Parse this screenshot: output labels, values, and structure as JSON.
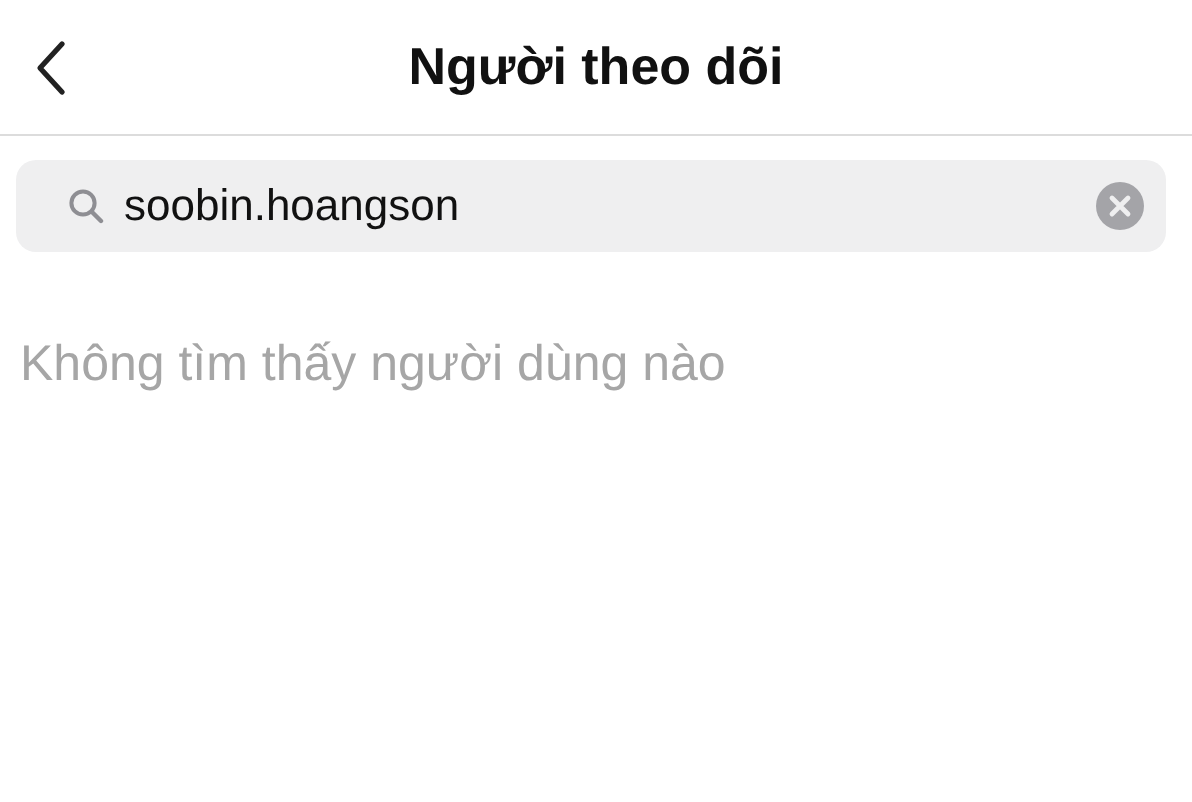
{
  "header": {
    "title": "Người theo dõi"
  },
  "search": {
    "value": "soobin.hoangson"
  },
  "empty_message": "Không tìm thấy người dùng nào"
}
